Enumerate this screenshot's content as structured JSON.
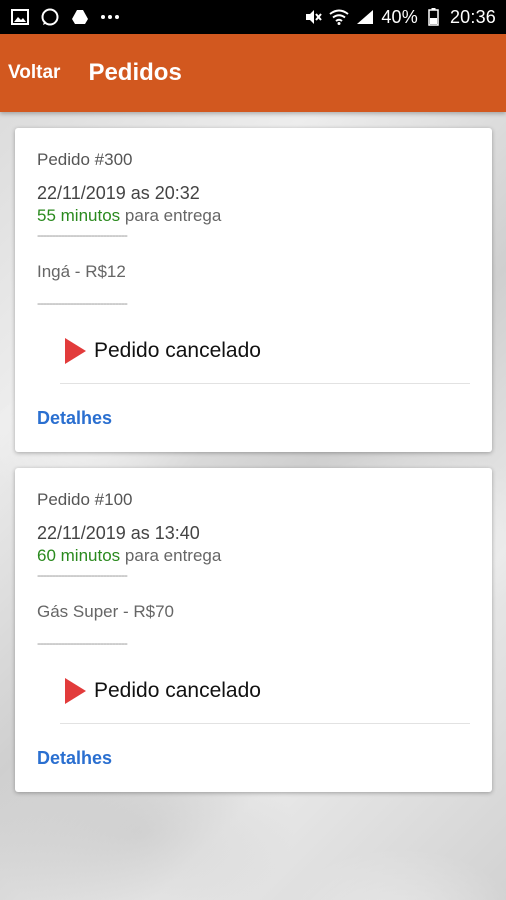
{
  "status_bar": {
    "icons_left": [
      "image-icon",
      "whatsapp-icon",
      "drive-icon",
      "more-icon"
    ],
    "icons_right": [
      "mute-icon",
      "wifi-icon",
      "signal-icon"
    ],
    "battery": "40%",
    "time": "20:36"
  },
  "app_bar": {
    "back_label": "Voltar",
    "title": "Pedidos",
    "color": "#d2581f"
  },
  "orders": [
    {
      "id": "Pedido #300",
      "datetime": "22/11/2019 as 20:32",
      "eta_value": "55 minutos",
      "eta_rest": "para entrega",
      "separator": "------------------------------",
      "item": "Ingá - R$12",
      "status": "Pedido cancelado",
      "details_label": "Detalhes"
    },
    {
      "id": "Pedido #100",
      "datetime": "22/11/2019 as 13:40",
      "eta_value": "60 minutos",
      "eta_rest": "para entrega",
      "separator": "------------------------------",
      "item": "Gás Super - R$70",
      "status": "Pedido cancelado",
      "details_label": "Detalhes"
    }
  ]
}
